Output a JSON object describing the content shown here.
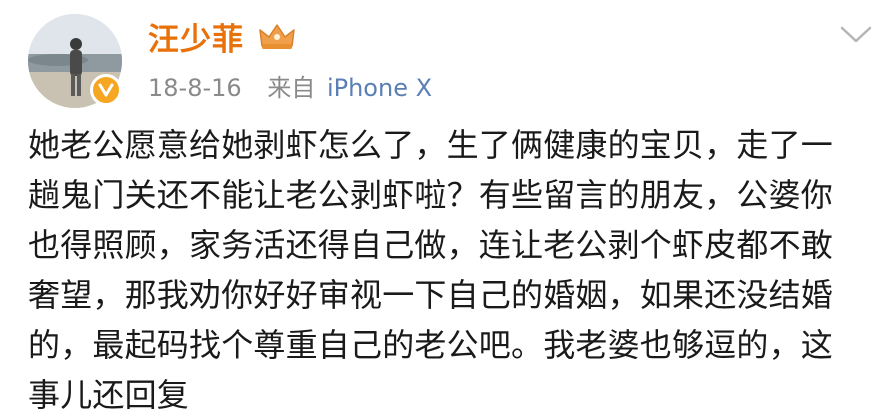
{
  "post": {
    "username": "汪少菲",
    "date": "18-8-16",
    "source_prefix": "来自",
    "source_device": "iPhone X",
    "icons": {
      "avatar": "avatar-photo",
      "verified": "verified-badge-icon",
      "member": "member-crown-icon",
      "expand": "chevron-down-icon"
    },
    "colors": {
      "username": "#e8710a",
      "verified": "#f5a623",
      "source_device": "#5b7fb5"
    },
    "content_lines": [
      "她老公愿意给她剥虾怎么了，生了俩健康的宝贝，走了一",
      "趟鬼门关还不能让老公剥虾啦？有些留言的朋友，公婆你",
      "也得照顾，家务活还得自己做，连让老公剥个虾皮都不敢",
      "奢望，那我劝你好好审视一下自己的婚姻，如果还没结婚",
      "的，最起码找个尊重自己的老公吧。我老婆也够逗的，这",
      "事儿还回复"
    ]
  }
}
